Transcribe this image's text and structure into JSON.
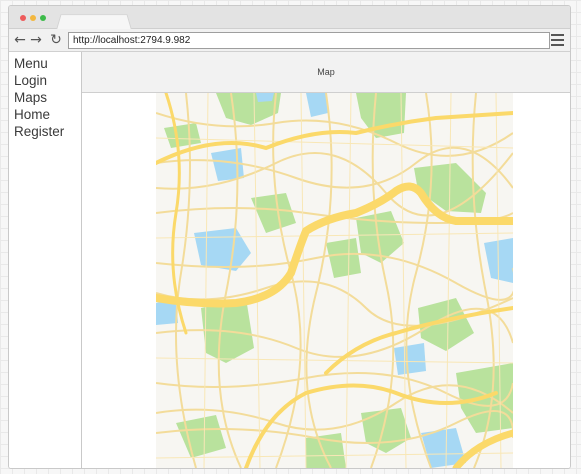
{
  "browser": {
    "url": "http://localhost:2794.9.982",
    "controls": {
      "back": "back-arrow-icon",
      "forward": "forward-arrow-icon",
      "reload": "reload-icon",
      "menu": "hamburger-menu-icon"
    }
  },
  "sidebar": {
    "heading": "Menu",
    "items": [
      {
        "label": "Login"
      },
      {
        "label": "Maps"
      },
      {
        "label": "Home"
      },
      {
        "label": "Register"
      }
    ]
  },
  "main": {
    "header_title": "Map"
  },
  "colors": {
    "park": "#b9e29d",
    "water": "#a6d8f4",
    "major_road": "#fbd96a",
    "street": "#f6e2a4",
    "land": "#f7f6f2"
  }
}
